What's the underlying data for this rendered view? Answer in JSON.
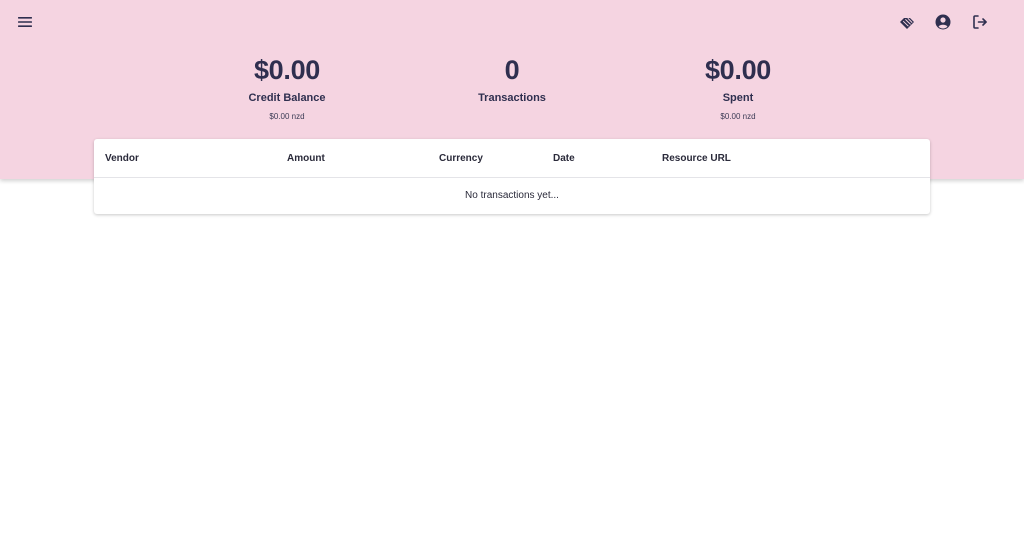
{
  "icons": {
    "menu": "menu-icon",
    "plan": "diamond-icon",
    "account": "account-circle-icon",
    "logout": "logout-icon"
  },
  "colors": {
    "header_bg": "#f5d4e1",
    "text_primary": "#2f2f4f"
  },
  "stats": {
    "credit": {
      "value": "$0.00",
      "label": "Credit Balance",
      "sub": "$0.00 nzd"
    },
    "transactions": {
      "value": "0",
      "label": "Transactions"
    },
    "spent": {
      "value": "$0.00",
      "label": "Spent",
      "sub": "$0.00 nzd"
    }
  },
  "table": {
    "columns": [
      "Vendor",
      "Amount",
      "Currency",
      "Date",
      "Resource URL"
    ],
    "empty_message": "No transactions yet..."
  }
}
